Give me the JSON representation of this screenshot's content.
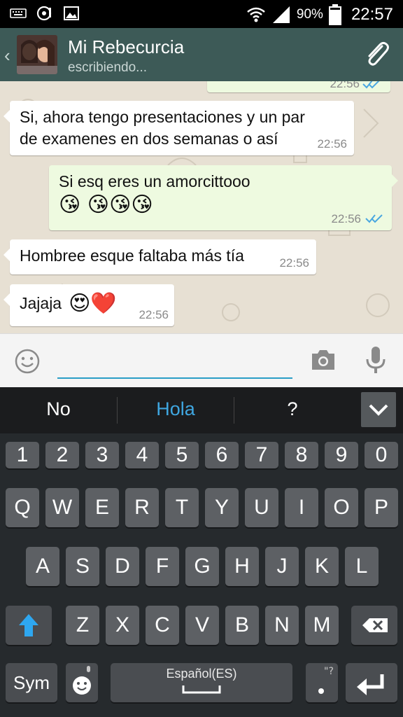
{
  "status_bar": {
    "icons": [
      "keyboard-icon",
      "music-icon",
      "image-icon",
      "wifi-icon",
      "signal-icon",
      "battery-icon"
    ],
    "battery": "90%",
    "time": "22:57"
  },
  "header": {
    "contact_name": "Mi Rebecurcia",
    "contact_status": "escribiendo...",
    "accent": "#3d5a57"
  },
  "messages": [
    {
      "direction": "in",
      "text_line1": "Si, ahora tengo presentaciones y un par",
      "text_line2": "de examenes en dos semanas o así",
      "time": "22:56"
    },
    {
      "direction": "out",
      "text": "Si esq eres un amorcittooo",
      "emoji": "😘 😘😘😘",
      "time": "22:56",
      "read": true
    },
    {
      "direction": "in",
      "text": "Hombree esque faltaba más tía",
      "time": "22:56"
    },
    {
      "direction": "in",
      "text": "Jajaja",
      "emoji": "😍❤️",
      "time": "22:56"
    }
  ],
  "input": {
    "placeholder": "",
    "value": ""
  },
  "suggestions": [
    "No",
    "Hola",
    "?"
  ],
  "keyboard": {
    "numbers": [
      "1",
      "2",
      "3",
      "4",
      "5",
      "6",
      "7",
      "8",
      "9",
      "0"
    ],
    "row1": [
      "Q",
      "W",
      "E",
      "R",
      "T",
      "Y",
      "U",
      "I",
      "O",
      "P"
    ],
    "row2": [
      "A",
      "S",
      "D",
      "F",
      "G",
      "H",
      "J",
      "K",
      "L"
    ],
    "row3": [
      "Z",
      "X",
      "C",
      "V",
      "B",
      "N",
      "M"
    ],
    "sym_label": "Sym",
    "space_label": "Español(ES)"
  }
}
